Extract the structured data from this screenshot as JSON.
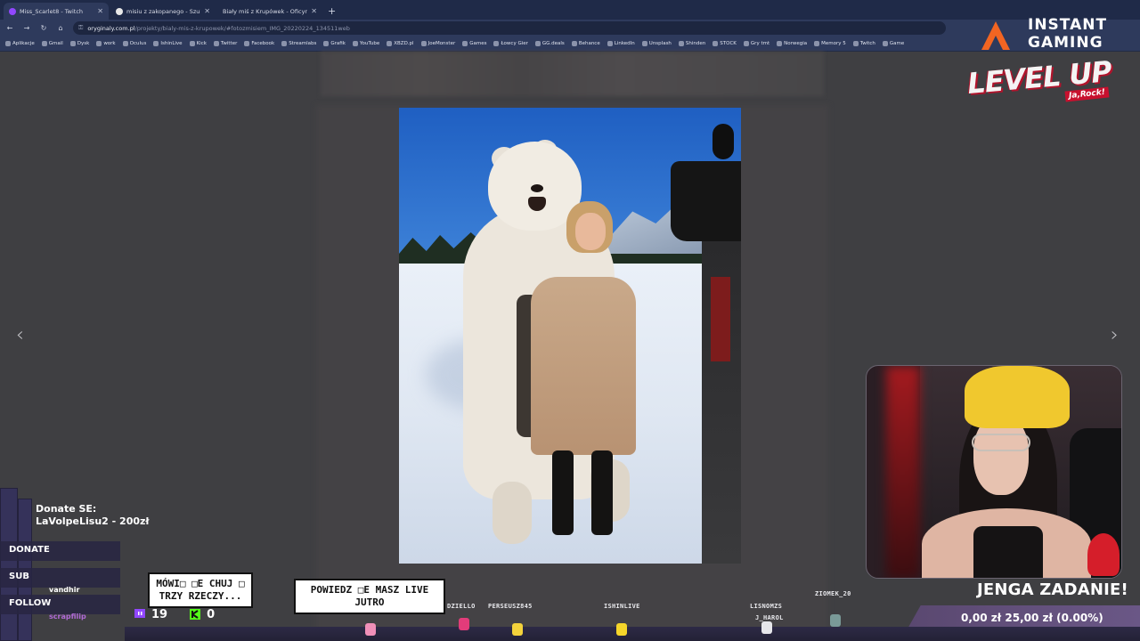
{
  "browser": {
    "tabs": [
      {
        "label": "Miss_Scarlet8 - Twitch",
        "active": true
      },
      {
        "label": "misiu z zakopanego - Szukaj w",
        "active": false
      },
      {
        "label": "Biały miś z Krupówek - Oficyn",
        "active": false
      }
    ],
    "new_tab_icon": "plus-icon",
    "url_host": "oryginaly.com.pl",
    "url_path": "/projekty/bialy-mis-z-krupowek/#fotozmisiem_IMG_20220224_134511web",
    "bookmarks": [
      "Aplikacje",
      "Gmail",
      "Dysk",
      "work",
      "Oculus",
      "IshinLive",
      "Kick",
      "Twitter",
      "Facebook",
      "Streamlabs",
      "Grafik",
      "YouTube",
      "XBZD.pl",
      "JoeMonster",
      "Games",
      "Łowcy Gier",
      "GG.deals",
      "Behance",
      "LinkedIn",
      "Unsplash",
      "Shinden",
      "STOCK",
      "Gry tmt",
      "Norwegia",
      "Memory 5",
      "Twitch",
      "Game"
    ]
  },
  "viewer": {
    "prev_arrow": "‹",
    "next_arrow": "›"
  },
  "overlay": {
    "brand_word1": "INSTANT",
    "brand_word2": "GAMING",
    "levelup": "LEVEL UP",
    "levelup_sub": "Ja,Rock!",
    "donate_label": "Donate SE:",
    "donate_value": "LaVolpeLisu2 - 200zł",
    "events": [
      {
        "label": "DONATE",
        "user": ""
      },
      {
        "label": "SUB",
        "user": "vandhir"
      },
      {
        "label": "FOLLOW",
        "user": "scrapfilip"
      }
    ],
    "bubble1": "MÓWI□ □E CHUJ □ TRZY RZECZY...",
    "bubble2": "POWIEDZ □E MASZ LIVE JUTRO",
    "counter1": "19",
    "counter2": "0",
    "chatters": [
      "DZIELLO",
      "PERSEUSZ845",
      "ISHINLIVE",
      "LISNOMZS",
      "J_HAROL",
      "ZIOMEK_20"
    ],
    "goal_title": "JENGA ZADANIE!",
    "goal_text": "0,00 zł  25,00 zł (0.00%)"
  },
  "colors": {
    "accent": "#c8102e",
    "chrome": "#2e3a5c",
    "tabstrip": "#1f2a48",
    "goal_bar": "#5a4870"
  }
}
